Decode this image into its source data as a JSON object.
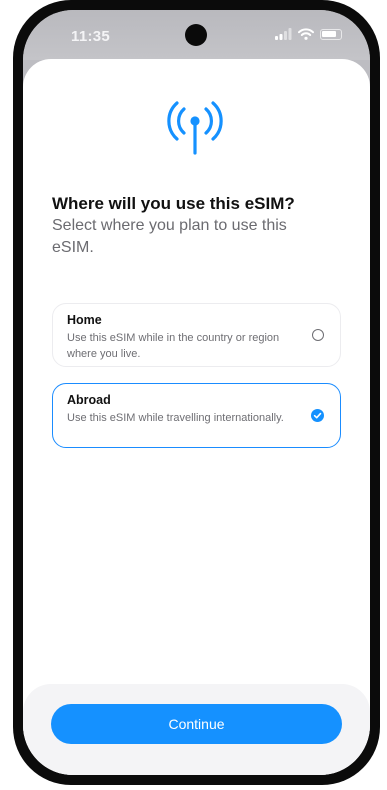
{
  "status_bar": {
    "time": "11:35"
  },
  "icons": {
    "header": "antenna-signal-icon",
    "signal": "cellular-signal-icon",
    "wifi": "wifi-icon",
    "battery": "battery-icon",
    "checked": "checkmark-circle-icon",
    "unchecked": "radio-circle-icon"
  },
  "colors": {
    "accent": "#1591ff",
    "selected_border": "#1a8cff",
    "title_text": "#111111",
    "secondary_text": "#6b6b70"
  },
  "main": {
    "title": "Where will you use this eSIM?",
    "subtitle": "Select where you plan to use this eSIM."
  },
  "options": [
    {
      "title": "Home",
      "description": "Use this eSIM while in the country or region where you live.",
      "selected": false
    },
    {
      "title": "Abroad",
      "description": "Use this eSIM while travelling internationally.",
      "selected": true
    }
  ],
  "footer": {
    "continue_label": "Continue"
  }
}
